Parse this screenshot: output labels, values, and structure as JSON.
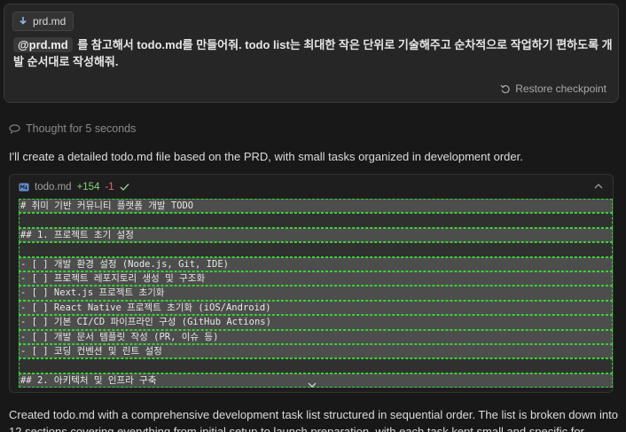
{
  "user_message": {
    "attachment": "prd.md",
    "mention": "@prd.md",
    "text": "를 참고해서 todo.md를 만들어줘. todo list는 최대한 작은 단위로 기술해주고 순차적으로 작업하기 편하도록 개발 순서대로 작성해줘.",
    "restore_label": "Restore checkpoint"
  },
  "thought": {
    "label": "Thought for 5 seconds"
  },
  "assistant": {
    "intro": "I'll create a detailed todo.md file based on the PRD, with small tasks organized in development order.",
    "summary": "Created todo.md with a comprehensive development task list structured in sequential order. The list is broken down into 12 sections covering everything from initial setup to launch preparation, with each task kept small and specific for"
  },
  "file": {
    "name": "todo.md",
    "added": "+154",
    "removed": "-1",
    "lines": [
      "# 취미 기반 커뮤니티 플랫폼 개발 TODO",
      "",
      "## 1. 프로젝트 초기 설정",
      "",
      "- [ ] 개발 환경 설정 (Node.js, Git, IDE)",
      "- [ ] 프로젝트 레포지토리 생성 및 구조화",
      "- [ ] Next.js 프로젝트 초기화",
      "- [ ] React Native 프로젝트 초기화 (iOS/Android)",
      "- [ ] 기본 CI/CD 파이프라인 구성 (GitHub Actions)",
      "- [ ] 개발 문서 템플릿 작성 (PR, 이슈 등)",
      "- [ ] 코딩 컨벤션 및 린트 설정",
      "",
      "## 2. 아키텍처 및 인프라 구축"
    ]
  }
}
